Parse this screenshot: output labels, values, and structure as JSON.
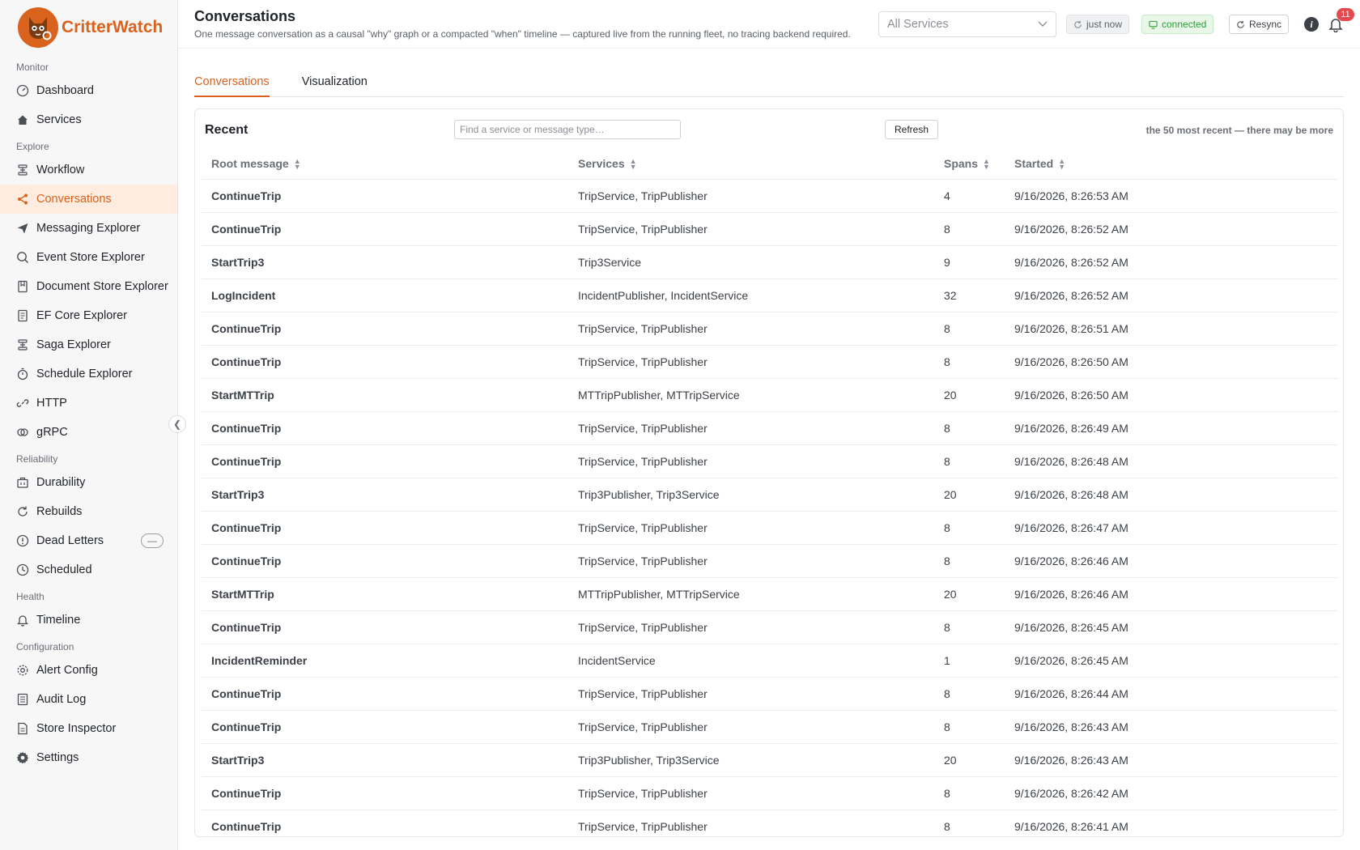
{
  "brand": {
    "name": "CritterWatch"
  },
  "sidebar": {
    "groups": [
      {
        "label": "Monitor",
        "items": [
          {
            "label": "Dashboard",
            "icon": "gauge-icon"
          },
          {
            "label": "Services",
            "icon": "home-icon"
          }
        ]
      },
      {
        "label": "Explore",
        "items": [
          {
            "label": "Workflow",
            "icon": "workflow-icon"
          },
          {
            "label": "Conversations",
            "icon": "share-icon",
            "active": true
          },
          {
            "label": "Messaging Explorer",
            "icon": "send-icon"
          },
          {
            "label": "Event Store Explorer",
            "icon": "search-icon"
          },
          {
            "label": "Document Store Explorer",
            "icon": "bookmark-icon"
          },
          {
            "label": "EF Core Explorer",
            "icon": "document-icon"
          },
          {
            "label": "Saga Explorer",
            "icon": "workflow-icon"
          },
          {
            "label": "Schedule Explorer",
            "icon": "stopwatch-icon"
          },
          {
            "label": "HTTP",
            "icon": "link-icon"
          },
          {
            "label": "gRPC",
            "icon": "grpc-icon"
          }
        ]
      },
      {
        "label": "Reliability",
        "items": [
          {
            "label": "Durability",
            "icon": "briefcase-icon"
          },
          {
            "label": "Rebuilds",
            "icon": "refresh-icon"
          },
          {
            "label": "Dead Letters",
            "icon": "alert-circle-icon",
            "badge": "—"
          },
          {
            "label": "Scheduled",
            "icon": "clock-icon"
          }
        ]
      },
      {
        "label": "Health",
        "items": [
          {
            "label": "Timeline",
            "icon": "bell-icon"
          }
        ]
      },
      {
        "label": "Configuration",
        "items": [
          {
            "label": "Alert Config",
            "icon": "gear-icon"
          },
          {
            "label": "Audit Log",
            "icon": "list-icon"
          },
          {
            "label": "Store Inspector",
            "icon": "file-icon"
          },
          {
            "label": "Settings",
            "icon": "cog-icon"
          }
        ]
      }
    ]
  },
  "header": {
    "title": "Conversations",
    "subtitle": "One message conversation as a causal \"why\" graph or a compacted \"when\" timeline — captured live from the running fleet, no tracing backend required.",
    "service_select": "All Services",
    "refresh_status": "just now",
    "connection_status": "connected",
    "resync_label": "Resync",
    "notification_count": "11"
  },
  "tabs": [
    {
      "label": "Conversations",
      "active": true
    },
    {
      "label": "Visualization",
      "active": false
    }
  ],
  "recent": {
    "title": "Recent",
    "search_placeholder": "Find a service or message type…",
    "refresh_label": "Refresh",
    "note": "the 50 most recent — there may be more",
    "columns": [
      "Root message",
      "Services",
      "Spans",
      "Started"
    ],
    "rows": [
      [
        "ContinueTrip",
        "TripService, TripPublisher",
        "4",
        "9/16/2026, 8:26:53 AM"
      ],
      [
        "ContinueTrip",
        "TripService, TripPublisher",
        "8",
        "9/16/2026, 8:26:52 AM"
      ],
      [
        "StartTrip3",
        "Trip3Service",
        "9",
        "9/16/2026, 8:26:52 AM"
      ],
      [
        "LogIncident",
        "IncidentPublisher, IncidentService",
        "32",
        "9/16/2026, 8:26:52 AM"
      ],
      [
        "ContinueTrip",
        "TripService, TripPublisher",
        "8",
        "9/16/2026, 8:26:51 AM"
      ],
      [
        "ContinueTrip",
        "TripService, TripPublisher",
        "8",
        "9/16/2026, 8:26:50 AM"
      ],
      [
        "StartMTTrip",
        "MTTripPublisher, MTTripService",
        "20",
        "9/16/2026, 8:26:50 AM"
      ],
      [
        "ContinueTrip",
        "TripService, TripPublisher",
        "8",
        "9/16/2026, 8:26:49 AM"
      ],
      [
        "ContinueTrip",
        "TripService, TripPublisher",
        "8",
        "9/16/2026, 8:26:48 AM"
      ],
      [
        "StartTrip3",
        "Trip3Publisher, Trip3Service",
        "20",
        "9/16/2026, 8:26:48 AM"
      ],
      [
        "ContinueTrip",
        "TripService, TripPublisher",
        "8",
        "9/16/2026, 8:26:47 AM"
      ],
      [
        "ContinueTrip",
        "TripService, TripPublisher",
        "8",
        "9/16/2026, 8:26:46 AM"
      ],
      [
        "StartMTTrip",
        "MTTripPublisher, MTTripService",
        "20",
        "9/16/2026, 8:26:46 AM"
      ],
      [
        "ContinueTrip",
        "TripService, TripPublisher",
        "8",
        "9/16/2026, 8:26:45 AM"
      ],
      [
        "IncidentReminder",
        "IncidentService",
        "1",
        "9/16/2026, 8:26:45 AM"
      ],
      [
        "ContinueTrip",
        "TripService, TripPublisher",
        "8",
        "9/16/2026, 8:26:44 AM"
      ],
      [
        "ContinueTrip",
        "TripService, TripPublisher",
        "8",
        "9/16/2026, 8:26:43 AM"
      ],
      [
        "StartTrip3",
        "Trip3Publisher, Trip3Service",
        "20",
        "9/16/2026, 8:26:43 AM"
      ],
      [
        "ContinueTrip",
        "TripService, TripPublisher",
        "8",
        "9/16/2026, 8:26:42 AM"
      ],
      [
        "ContinueTrip",
        "TripService, TripPublisher",
        "8",
        "9/16/2026, 8:26:41 AM"
      ]
    ]
  },
  "colors": {
    "accent": "#d9621c",
    "active_bg": "#fdecdf",
    "connected": "#2f9d3b",
    "badge": "#e5484d"
  }
}
